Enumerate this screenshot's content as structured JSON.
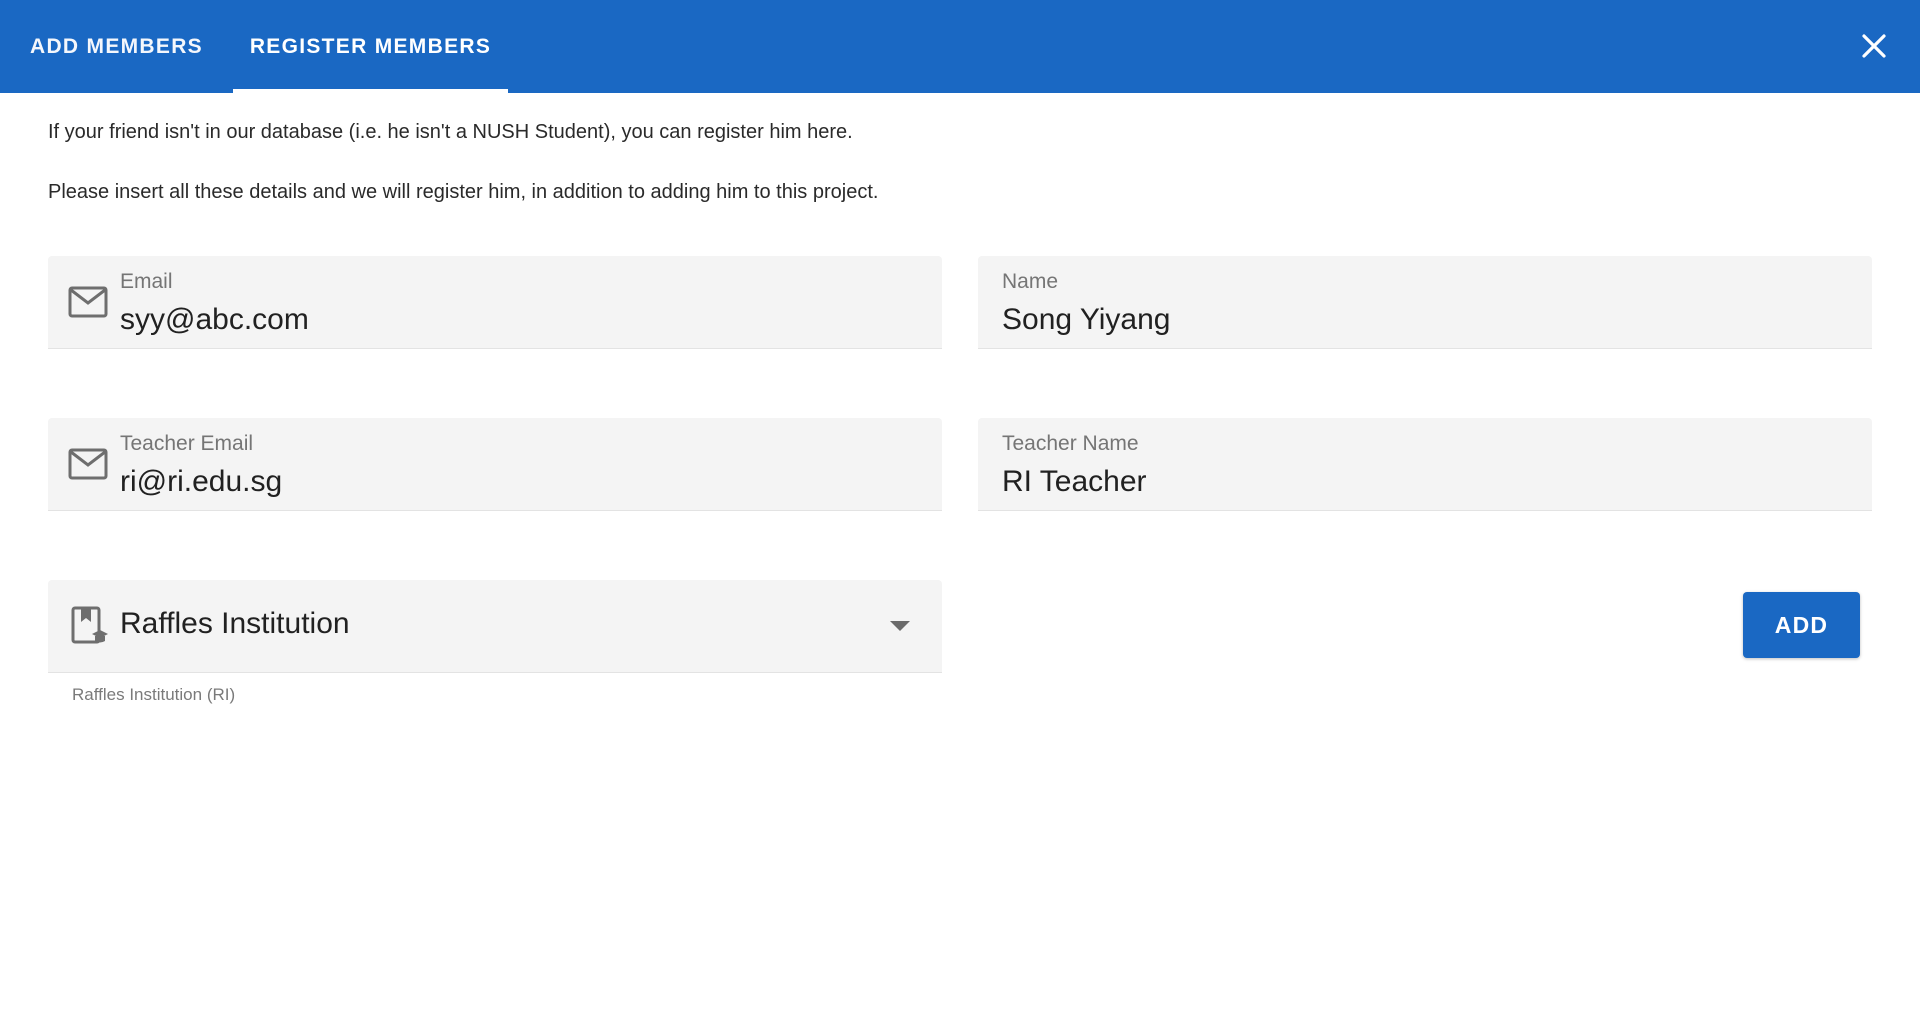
{
  "tabs": [
    {
      "label": "ADD MEMBERS",
      "active": false
    },
    {
      "label": "REGISTER MEMBERS",
      "active": true
    }
  ],
  "header": {
    "background": "#1a68c3",
    "close_icon": "close-icon"
  },
  "intro": {
    "line1": "If your friend isn't in our database (i.e. he isn't a NUSH Student), you can register him here.",
    "line2": "Please insert all these details and we will register him, in addition to adding him to this project."
  },
  "form": {
    "email": {
      "label": "Email",
      "value": "syy@abc.com",
      "icon": "mail-icon"
    },
    "name": {
      "label": "Name",
      "value": "Song Yiyang"
    },
    "teacher_email": {
      "label": "Teacher Email",
      "value": "ri@ri.edu.sg",
      "icon": "mail-icon"
    },
    "teacher_name": {
      "label": "Teacher Name",
      "value": "RI Teacher"
    },
    "school": {
      "value": "Raffles Institution",
      "helper": "Raffles Institution (RI)",
      "icon": "school-bookmark-icon"
    }
  },
  "actions": {
    "add_label": "ADD"
  }
}
